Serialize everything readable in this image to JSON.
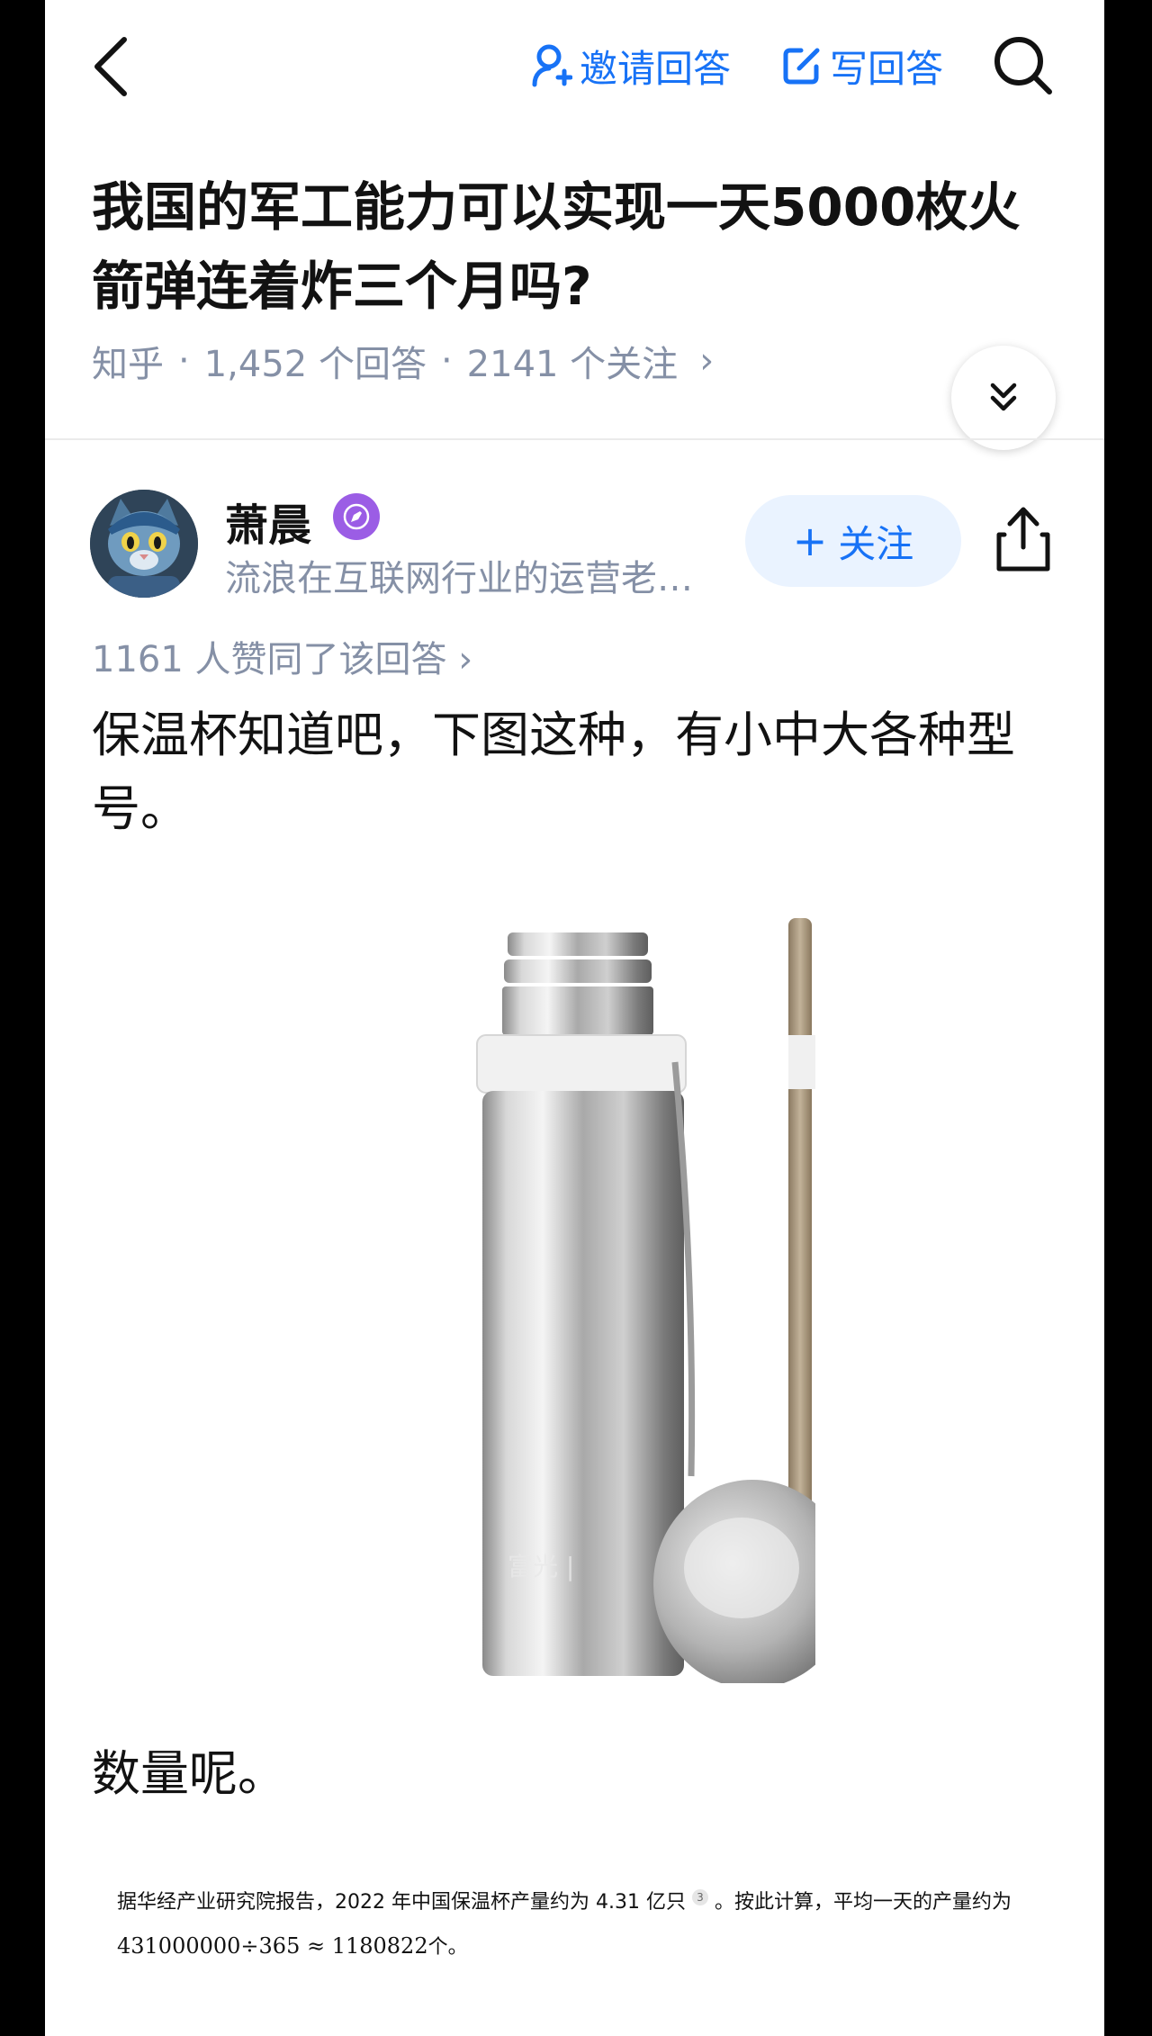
{
  "header": {
    "invite_label": "邀请回答",
    "write_label": "写回答"
  },
  "question": {
    "title": "我国的军工能力可以实现一天5000枚火箭弹连着炸三个月吗?",
    "source": "知乎",
    "answers_count": "1,452 个回答",
    "follows_count": "2141 个关注",
    "meta_arrow": "›"
  },
  "author": {
    "name": "萧晨",
    "bio": "流浪在互联网行业的运营老…",
    "follow_label": "关注",
    "follow_plus": "+"
  },
  "answer": {
    "votes_text": "1161 人赞同了该回答 ›",
    "paragraph_1": "保温杯知道吧，下图这种，有小中大各种型号。",
    "image_alt": "stainless-steel-vacuum-flask",
    "paragraph_2": "数量呢。",
    "citation_text": "据华经产业研究院报告，2022 年中国保温杯产量约为 4.31 亿只",
    "citation_ref": "3",
    "citation_tail": "。按此计算，平均一天的产量约为",
    "citation_formula": "431000000÷365 ≈ 1180822",
    "citation_unit": "个。"
  },
  "colors": {
    "accent": "#1772f6",
    "muted": "#8590a6",
    "text": "#121212",
    "badge": "#9b5de5"
  }
}
